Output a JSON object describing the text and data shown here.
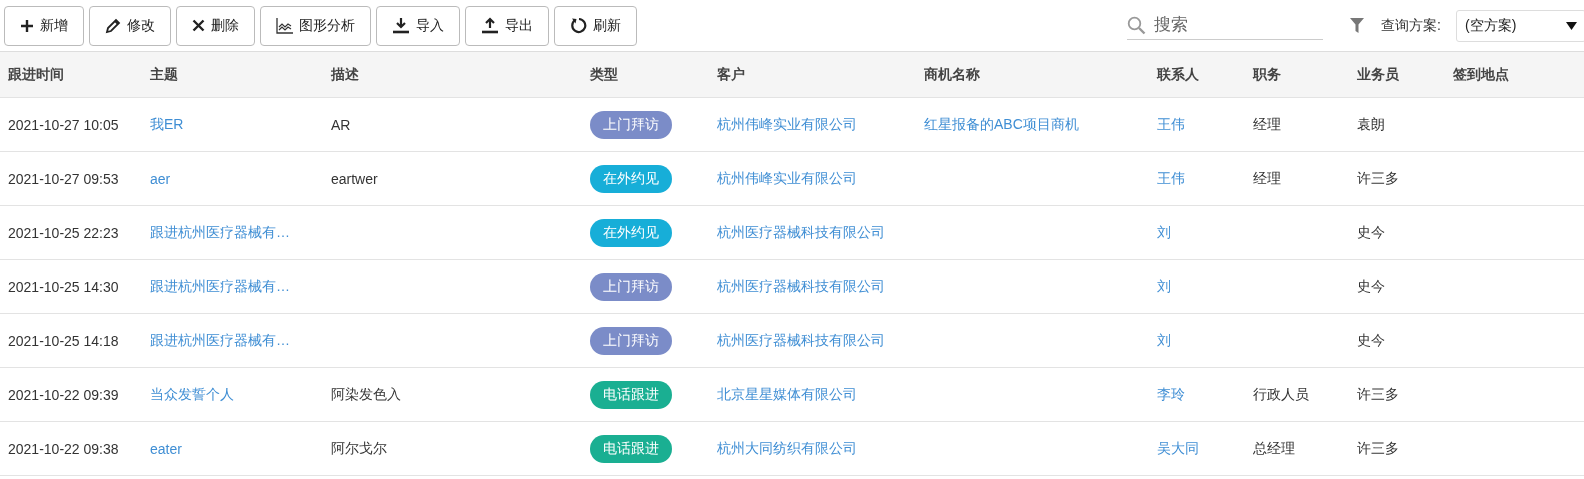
{
  "toolbar": {
    "buttons": [
      {
        "kind": "add",
        "label": "新增"
      },
      {
        "kind": "edit",
        "label": "修改"
      },
      {
        "kind": "delete",
        "label": "删除"
      },
      {
        "kind": "chart",
        "label": "图形分析"
      },
      {
        "kind": "import",
        "label": "导入"
      },
      {
        "kind": "export",
        "label": "导出"
      },
      {
        "kind": "refresh",
        "label": "刷新"
      }
    ],
    "search": {
      "placeholder": "搜索"
    },
    "query_label": "查询方案:",
    "query_select": {
      "value": "(空方案)"
    }
  },
  "table": {
    "columns": [
      {
        "label": "跟进时间",
        "kind": "text"
      },
      {
        "label": "主题",
        "kind": "link"
      },
      {
        "label": "描述",
        "kind": "text"
      },
      {
        "label": "类型",
        "kind": "tag"
      },
      {
        "label": "客户",
        "kind": "link"
      },
      {
        "label": "商机名称",
        "kind": "link"
      },
      {
        "label": "联系人",
        "kind": "link"
      },
      {
        "label": "职务",
        "kind": "text"
      },
      {
        "label": "业务员",
        "kind": "text"
      },
      {
        "label": "签到地点"
      }
    ],
    "rows": [
      {
        "cells": [
          "2021-10-27 10:05",
          "我ER",
          "AR",
          {
            "label": "上门拜访",
            "color": "#7b8cc8"
          },
          "杭州伟峰实业有限公司",
          "红星报备的ABC项目商机",
          "王伟",
          "经理",
          "袁朗",
          null
        ]
      },
      {
        "cells": [
          "2021-10-27 09:53",
          "aer",
          "eartwer",
          {
            "label": "在外约见",
            "color": "#17aed8"
          },
          "杭州伟峰实业有限公司",
          null,
          "王伟",
          "经理",
          "许三多",
          null
        ]
      },
      {
        "cells": [
          "2021-10-25 22:23",
          "跟进杭州医疗器械有…",
          null,
          {
            "label": "在外约见",
            "color": "#17aed8"
          },
          "杭州医疗器械科技有限公司",
          null,
          "刘",
          null,
          "史今",
          null
        ]
      },
      {
        "cells": [
          "2021-10-25 14:30",
          "跟进杭州医疗器械有…",
          null,
          {
            "label": "上门拜访",
            "color": "#7b8cc8"
          },
          "杭州医疗器械科技有限公司",
          null,
          "刘",
          null,
          "史今",
          null
        ]
      },
      {
        "cells": [
          "2021-10-25 14:18",
          "跟进杭州医疗器械有…",
          null,
          {
            "label": "上门拜访",
            "color": "#7b8cc8"
          },
          "杭州医疗器械科技有限公司",
          null,
          "刘",
          null,
          "史今",
          null
        ]
      },
      {
        "cells": [
          "2021-10-22 09:39",
          "当众发誓个人",
          "阿染发色入",
          {
            "label": "电话跟进",
            "color": "#1aaf92"
          },
          "北京星星媒体有限公司",
          null,
          "李玲",
          "行政人员",
          "许三多",
          null
        ]
      },
      {
        "cells": [
          "2021-10-22 09:38",
          "eater",
          "阿尔戈尔",
          {
            "label": "电话跟进",
            "color": "#1aaf92"
          },
          "杭州大同纺织有限公司",
          null,
          "吴大同",
          "总经理",
          "许三多",
          null
        ]
      }
    ]
  }
}
